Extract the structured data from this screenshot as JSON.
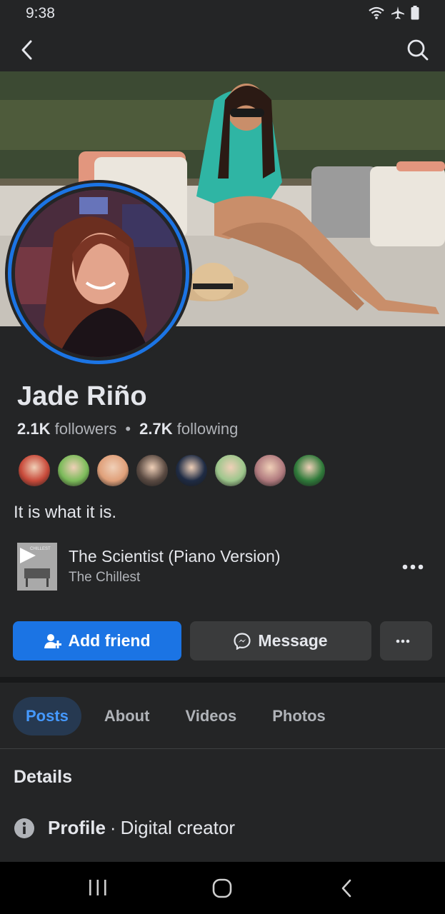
{
  "status_bar": {
    "time": "9:38"
  },
  "profile": {
    "name": "Jade Riño",
    "followers_count": "2.1K",
    "followers_label": "followers",
    "following_count": "2.7K",
    "following_label": "following",
    "bio": "It is what it is."
  },
  "mutual_friends": [
    {
      "color": "#c84a3a"
    },
    {
      "color": "#7cbb5a"
    },
    {
      "color": "#e0a07a"
    },
    {
      "color": "#5a4a42"
    },
    {
      "color": "#1e2b44"
    },
    {
      "color": "#9dc68c"
    },
    {
      "color": "#b07a7e"
    },
    {
      "color": "#2f7a3a"
    }
  ],
  "music": {
    "cover_label": "CHILLEST",
    "title": "The Scientist (Piano Version)",
    "artist": "The Chillest"
  },
  "actions": {
    "add_friend": "Add friend",
    "message": "Message"
  },
  "tabs": [
    {
      "label": "Posts",
      "active": true
    },
    {
      "label": "About",
      "active": false
    },
    {
      "label": "Videos",
      "active": false
    },
    {
      "label": "Photos",
      "active": false
    }
  ],
  "details": {
    "title": "Details",
    "label": "Profile",
    "separator": "·",
    "value": "Digital creator"
  },
  "colors": {
    "accent": "#1b74e4",
    "background": "#242526"
  },
  "icons": [
    "back-icon",
    "search-icon",
    "wifi-icon",
    "airplane-icon",
    "battery-icon",
    "more-icon",
    "add-friend-icon",
    "messenger-icon",
    "info-icon"
  ]
}
